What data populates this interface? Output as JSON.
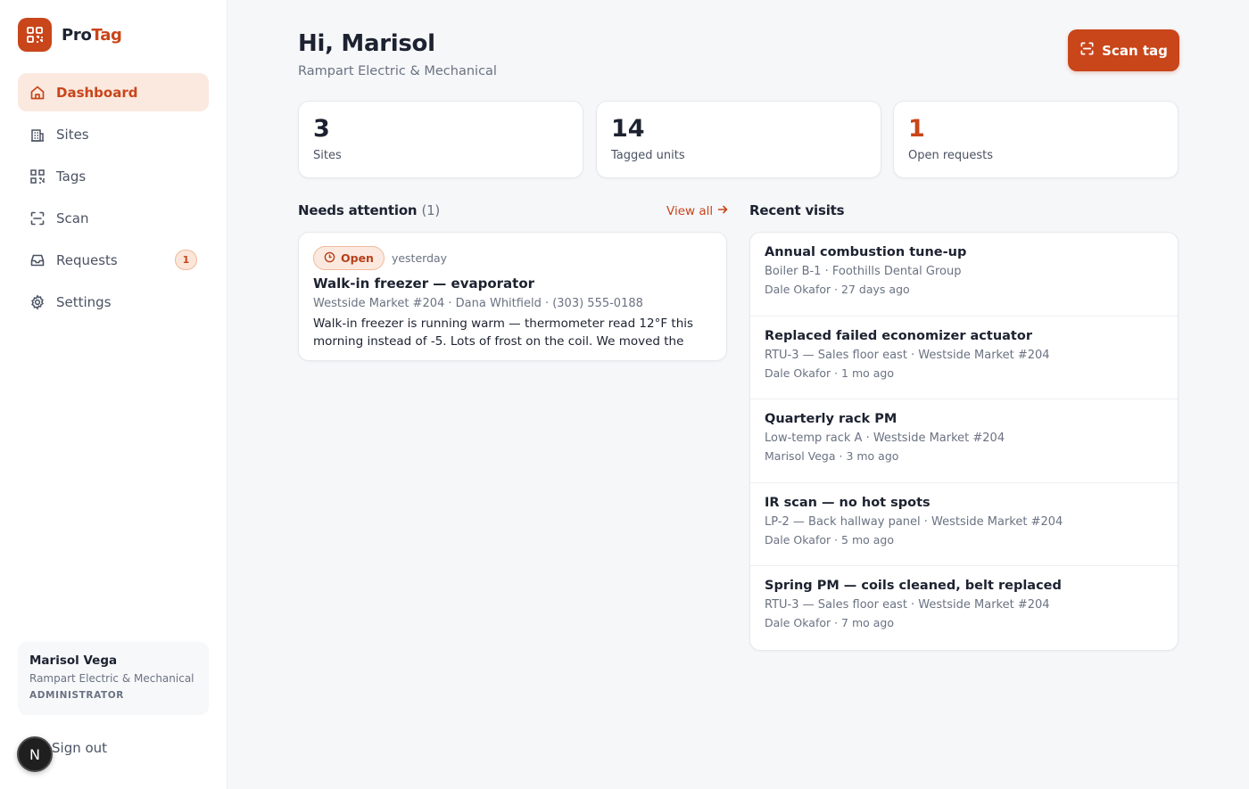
{
  "brand": {
    "name_prefix": "Pro",
    "name_suffix": "Tag",
    "color": "#c9451a"
  },
  "sidebar": {
    "items": [
      {
        "label": "Dashboard",
        "icon": "home-icon",
        "active": true
      },
      {
        "label": "Sites",
        "icon": "building-icon"
      },
      {
        "label": "Tags",
        "icon": "qr-code-icon"
      },
      {
        "label": "Scan",
        "icon": "scan-icon"
      },
      {
        "label": "Requests",
        "icon": "inbox-icon",
        "badge": "1"
      },
      {
        "label": "Settings",
        "icon": "gear-icon"
      }
    ],
    "user": {
      "name": "Marisol Vega",
      "org": "Rampart Electric & Mechanical",
      "role": "ADMINISTRATOR"
    },
    "sign_out": "Sign out",
    "dev_bubble": "N"
  },
  "header": {
    "greeting": "Hi, Marisol",
    "company": "Rampart Electric & Mechanical",
    "scan_button": "Scan tag"
  },
  "stats": [
    {
      "value": "3",
      "label": "Sites"
    },
    {
      "value": "14",
      "label": "Tagged units"
    },
    {
      "value": "1",
      "label": "Open requests"
    }
  ],
  "attention": {
    "title": "Needs attention",
    "count": "(1)",
    "view_all": "View all",
    "item": {
      "status": "Open",
      "when": "yesterday",
      "title": "Walk-in freezer — evaporator",
      "meta": "Westside Market #204 · Dana Whitfield · (303) 555-0188",
      "body": "Walk-in freezer is running warm — thermometer read 12°F this morning instead of -5. Lots of frost on the coil. We moved the ice..."
    }
  },
  "visits": {
    "title": "Recent visits",
    "items": [
      {
        "title": "Annual combustion tune-up",
        "meta": "Boiler B-1 · Foothills Dental Group",
        "by": "Dale Okafor · 27 days ago"
      },
      {
        "title": "Replaced failed economizer actuator",
        "meta": "RTU-3 — Sales floor east · Westside Market #204",
        "by": "Dale Okafor · 1 mo ago"
      },
      {
        "title": "Quarterly rack PM",
        "meta": "Low-temp rack A · Westside Market #204",
        "by": "Marisol Vega · 3 mo ago"
      },
      {
        "title": "IR scan — no hot spots",
        "meta": "LP-2 — Back hallway panel · Westside Market #204",
        "by": "Dale Okafor · 5 mo ago"
      },
      {
        "title": "Spring PM — coils cleaned, belt replaced",
        "meta": "RTU-3 — Sales floor east · Westside Market #204",
        "by": "Dale Okafor · 7 mo ago"
      }
    ]
  }
}
